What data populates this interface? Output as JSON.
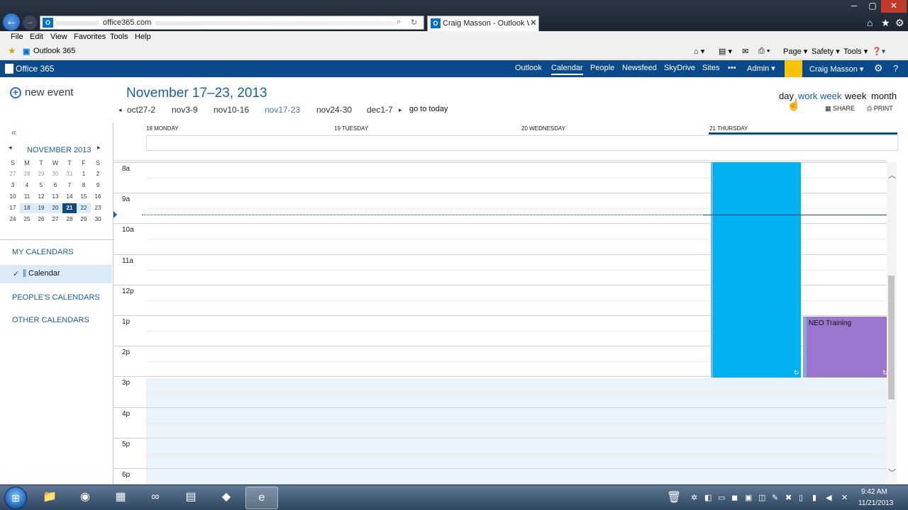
{
  "browser": {
    "address": "office365.com",
    "tab_title": "Craig Masson - Outlook We...",
    "tab_close": "✕",
    "window_controls": [
      "─",
      "▢",
      "✕"
    ],
    "toolbar_icons": [
      "home-icon",
      "favorites-star-icon",
      "settings-gear-icon"
    ],
    "menu": [
      "File",
      "Edit",
      "View",
      "Favorites",
      "Tools",
      "Help"
    ],
    "favorites_item": "Outlook 365",
    "command_bar": [
      "Page ▾",
      "Safety ▾",
      "Tools ▾"
    ]
  },
  "o365": {
    "title": "Office 365",
    "nav": [
      "Outlook",
      "Calendar",
      "People",
      "Newsfeed",
      "SkyDrive",
      "Sites",
      "•••",
      "Admin ▾"
    ],
    "user": "Craig Masson ▾",
    "accent": "#0a4a8a"
  },
  "left": {
    "new_event": "new event",
    "collapse": "«",
    "mini_cal": {
      "title": "NOVEMBER 2013",
      "prev": "◂",
      "next": "▸",
      "dow": [
        "S",
        "M",
        "T",
        "W",
        "T",
        "F",
        "S"
      ],
      "weeks": [
        [
          "27",
          "28",
          "29",
          "30",
          "31",
          "1",
          "2"
        ],
        [
          "3",
          "4",
          "5",
          "6",
          "7",
          "8",
          "9"
        ],
        [
          "10",
          "11",
          "12",
          "13",
          "14",
          "15",
          "16"
        ],
        [
          "17",
          "18",
          "19",
          "20",
          "21",
          "22",
          "23"
        ],
        [
          "24",
          "25",
          "26",
          "27",
          "28",
          "29",
          "30"
        ]
      ],
      "today": "21"
    },
    "my_calendars": "MY CALENDARS",
    "calendar_check": "✓",
    "calendar_name": "Calendar",
    "peoples_calendars": "PEOPLE'S CALENDARS",
    "other_calendars": "OTHER CALENDARS"
  },
  "header": {
    "range_title": "November 17–23, 2013",
    "prev": "◂",
    "next": "▸",
    "weeks": [
      "oct27-2",
      "nov3-9",
      "nov10-16",
      "nov17-23",
      "nov24-30",
      "dec1-7"
    ],
    "current_week": "nov17-23",
    "go_to_today": "go to today",
    "views": [
      "day",
      "work week",
      "week",
      "month"
    ],
    "share": "SHARE",
    "print": "PRINT"
  },
  "days": [
    "18 MONDAY",
    "19 TUESDAY",
    "20 WEDNESDAY",
    "21 THURSDAY"
  ],
  "hours": [
    "8a",
    "9a",
    "10a",
    "11a",
    "12p",
    "1p",
    "2p",
    "3p",
    "4p",
    "5p",
    "6p"
  ],
  "events": {
    "busy_color": "#00b1f0",
    "neo": {
      "title": "NEO Training",
      "color": "#9977cf"
    }
  },
  "taskbar": {
    "apps": [
      "folder-icon",
      "chrome-icon",
      "app-red-icon",
      "visual-studio-icon",
      "explorer-icon",
      "media-icon",
      "internet-explorer-icon"
    ],
    "time": "9:42 AM",
    "date": "11/21/2013"
  }
}
